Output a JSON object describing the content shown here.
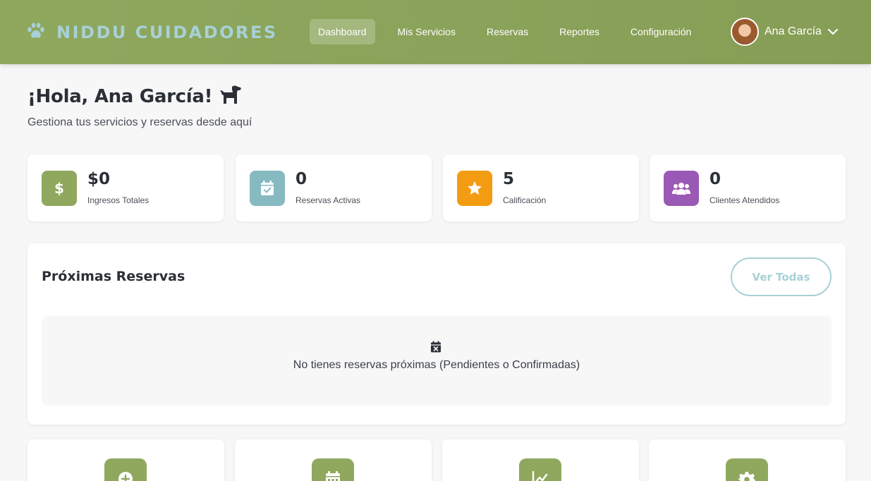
{
  "brand": {
    "name": "NIDDU CUIDADORES",
    "icon": "paw-icon"
  },
  "nav": {
    "items": [
      {
        "label": "Dashboard",
        "active": true
      },
      {
        "label": "Mis Servicios",
        "active": false
      },
      {
        "label": "Reservas",
        "active": false
      },
      {
        "label": "Reportes",
        "active": false
      },
      {
        "label": "Configuración",
        "active": false
      }
    ]
  },
  "user": {
    "name": "Ana García",
    "menu_icon": "chevron-down-icon"
  },
  "greeting": {
    "title": "¡Hola, Ana García!",
    "icon": "dog-icon",
    "subtitle": "Gestiona tus servicios y reservas desde aquí"
  },
  "stats": [
    {
      "value": "$0",
      "label": "Ingresos Totales",
      "icon": "dollar-icon",
      "color": "#8fa85e"
    },
    {
      "value": "0",
      "label": "Reservas Activas",
      "icon": "calendar-check-icon",
      "color": "#86b9c0"
    },
    {
      "value": "5",
      "label": "Calificación",
      "icon": "star-icon",
      "color": "#f39c12"
    },
    {
      "value": "0",
      "label": "Clientes Atendidos",
      "icon": "users-icon",
      "color": "#9b59b6"
    }
  ],
  "upcoming": {
    "title": "Próximas Reservas",
    "view_all_label": "Ver Todas",
    "empty_icon": "calendar-x-icon",
    "empty_text": "No tienes reservas próximas (Pendientes o Confirmadas)"
  },
  "quick_actions": [
    {
      "icon": "plus-circle-icon"
    },
    {
      "icon": "calendar-icon"
    },
    {
      "icon": "chart-line-icon"
    },
    {
      "icon": "gear-icon"
    }
  ],
  "colors": {
    "header": "#8fa85e",
    "brand_text": "#a8d0d6",
    "accent": "#a8d0d6"
  }
}
